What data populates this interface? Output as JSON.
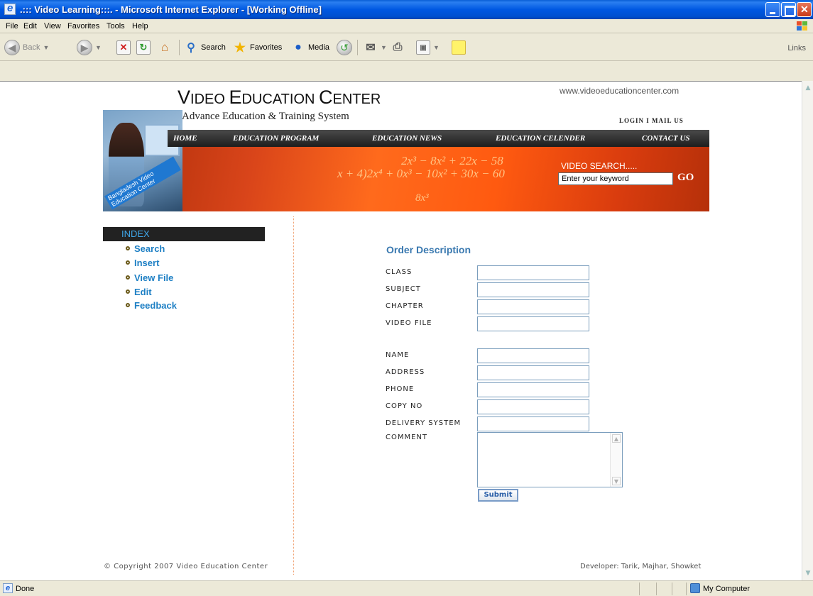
{
  "window": {
    "title": ".::: Video Learning:::. - Microsoft Internet Explorer - [Working Offline]"
  },
  "menubar": {
    "items": [
      "File",
      "Edit",
      "View",
      "Favorites",
      "Tools",
      "Help"
    ]
  },
  "toolbar": {
    "back": "Back",
    "search": "Search",
    "favorites": "Favorites",
    "media": "Media",
    "links": "Links"
  },
  "site": {
    "url_text": "www.videoeducationcenter.com",
    "logo_first_v": "V",
    "logo_rest_1": "IDEO ",
    "logo_e": "E",
    "logo_rest_2": "DUCATION ",
    "logo_c": "C",
    "logo_rest_3": "ENTER",
    "subtitle": "Advance Education & Training System",
    "login_mail": "LOGIN I MAIL US",
    "banner_tag": "Bangladesh Video Education Center",
    "math_line_1": "2x³ − 8x² + 22x − 58",
    "math_line_2": "x + 4)2x⁴ + 0x³ − 10x² + 30x − 60",
    "math_line_3": "8x³",
    "nav": [
      "HOME",
      "EDUCATION PROGRAM",
      "EDUCATION NEWS",
      "EDUCATION CELENDER",
      "CONTACT US"
    ],
    "video_search_label": "VIDEO SEARCH.....",
    "video_search_value": "Enter your keyword",
    "go_label": "GO"
  },
  "sidebar": {
    "index_title": "INDEX",
    "links": [
      "Search",
      "Insert",
      "View File",
      "Edit",
      "Feedback"
    ]
  },
  "form": {
    "title": "Order Description",
    "fields_1": [
      "CLASS",
      "SUBJECT",
      "CHAPTER",
      "VIDEO FILE"
    ],
    "fields_2": [
      "NAME",
      "ADDRESS",
      "PHONE",
      "COPY NO",
      "DELIVERY SYSTEM"
    ],
    "comment_label": "COMMENT",
    "submit_label": "Submit"
  },
  "footer": {
    "copyright": "© Copyright 2007 Video Education Center",
    "developer": "Developer: Tarik, Majhar, Showket"
  },
  "statusbar": {
    "status": "Done",
    "zone": "My Computer"
  },
  "colors": {
    "titlebar": "#0058e2",
    "link_blue": "#1d7fc4",
    "banner_orange": "#ff6a1c",
    "nav_dark": "#1e1e1e"
  }
}
